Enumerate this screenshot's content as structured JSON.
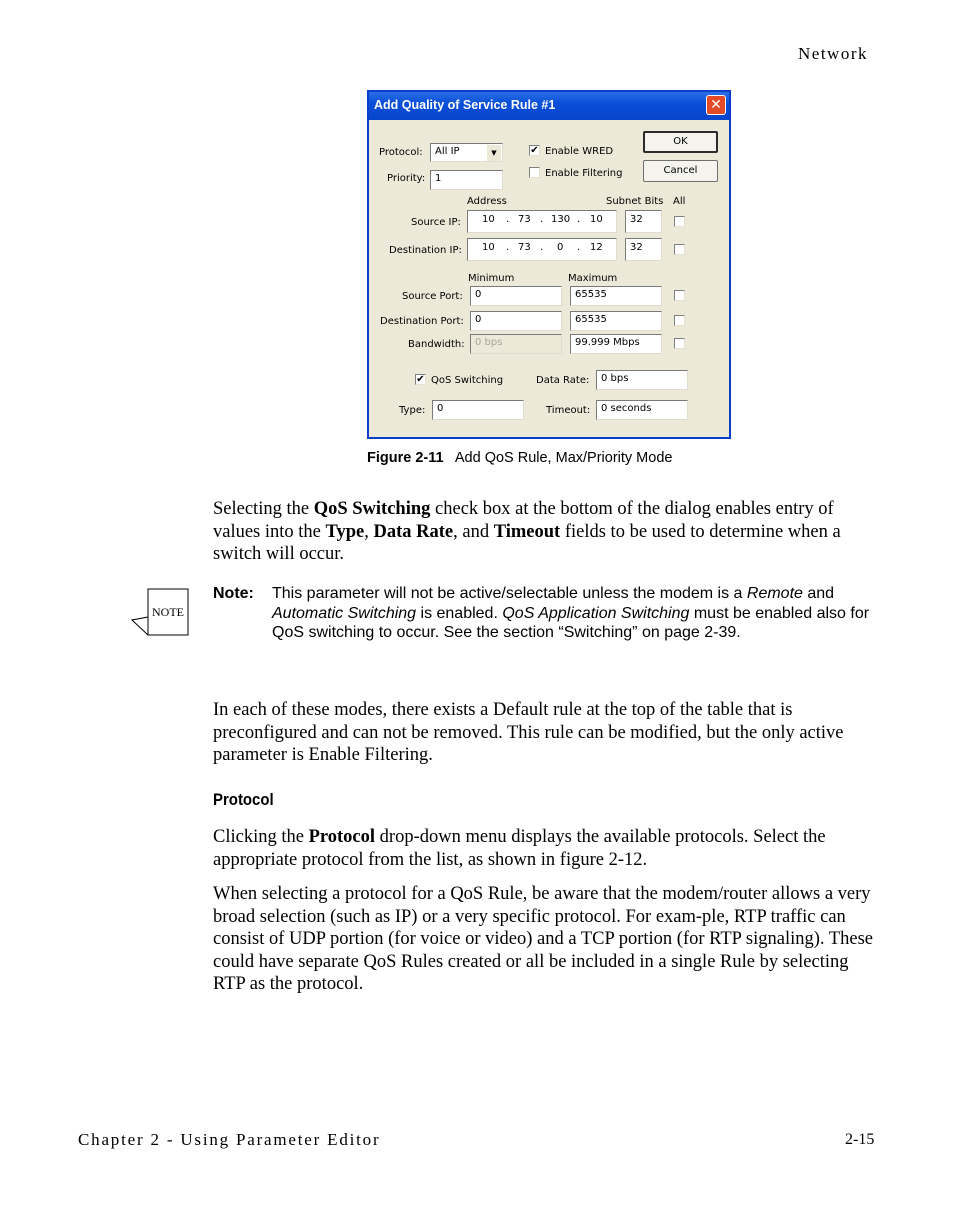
{
  "page": {
    "header_section": "Network",
    "footer_chapter": "Chapter 2 - Using Parameter Editor",
    "footer_page": "2-15"
  },
  "dialog": {
    "title": "Add Quality of Service Rule #1",
    "close_glyph": "✕",
    "protocol_label": "Protocol:",
    "protocol_value": "All IP",
    "priority_label": "Priority:",
    "priority_value": "1",
    "enable_wred_label": "Enable WRED",
    "enable_wred_checked": true,
    "enable_filtering_label": "Enable Filtering",
    "enable_filtering_checked": false,
    "ok_label": "OK",
    "cancel_label": "Cancel",
    "col_address": "Address",
    "col_subnet_bits": "Subnet Bits",
    "col_all": "All",
    "source_ip_label": "Source IP:",
    "source_ip": [
      "10",
      "73",
      "130",
      "10"
    ],
    "source_subnet": "32",
    "dest_ip_label": "Destination IP:",
    "dest_ip": [
      "10",
      "73",
      "0",
      "12"
    ],
    "dest_subnet": "32",
    "col_minimum": "Minimum",
    "col_maximum": "Maximum",
    "source_port_label": "Source Port:",
    "source_port_min": "0",
    "source_port_max": "65535",
    "dest_port_label": "Destination Port:",
    "dest_port_min": "0",
    "dest_port_max": "65535",
    "bandwidth_label": "Bandwidth:",
    "bandwidth_min": "0 bps",
    "bandwidth_max": "99.999 Mbps",
    "qos_switching_label": "QoS Switching",
    "qos_switching_checked": true,
    "data_rate_label": "Data Rate:",
    "data_rate_value": "0 bps",
    "type_label": "Type:",
    "type_value": "0",
    "timeout_label": "Timeout:",
    "timeout_value": "0 seconds",
    "check_glyph": "✔",
    "dropdown_glyph": "▼"
  },
  "figure": {
    "number": "Figure 2-11",
    "caption": "Add QoS Rule, Max/Priority Mode"
  },
  "body": {
    "p1_a": "Selecting the ",
    "p1_b": "QoS Switching",
    "p1_c": " check box at the bottom of the dialog enables entry of values into the ",
    "p1_d": "Type",
    "p1_e": ", ",
    "p1_f": "Data Rate",
    "p1_g": ", and ",
    "p1_h": "Timeout",
    "p1_i": " fields to be used to determine when a switch will occur.",
    "note_icon_text": "NOTE",
    "note_label": "Note:",
    "note_a": "This parameter will not be active/selectable unless the modem is a ",
    "note_b": "Remote",
    "note_c": " and ",
    "note_d": "Automatic Switching",
    "note_e": " is enabled. ",
    "note_f": "QoS Application Switching",
    "note_g": " must be enabled also for QoS switching to occur. See the section “Switching” on page 2-39.",
    "p2": "In each of these modes, there exists a Default rule at the top of the table that is preconfigured and can not be removed. This rule can be modified, but the only active parameter is Enable Filtering.",
    "subheading": "Protocol",
    "p3_a": "Clicking the ",
    "p3_b": "Protocol",
    "p3_c": " drop-down menu displays the available protocols. Select the appropriate protocol from the list, as shown in figure 2-12.",
    "p4": "When selecting a protocol for a QoS Rule, be aware that the modem/router allows a very broad selection (such as IP) or a very specific protocol. For exam-ple, RTP traffic can consist of UDP portion (for voice or video) and a TCP portion (for RTP signaling). These could have separate QoS Rules created or all be included in a single Rule by selecting RTP as the protocol."
  }
}
